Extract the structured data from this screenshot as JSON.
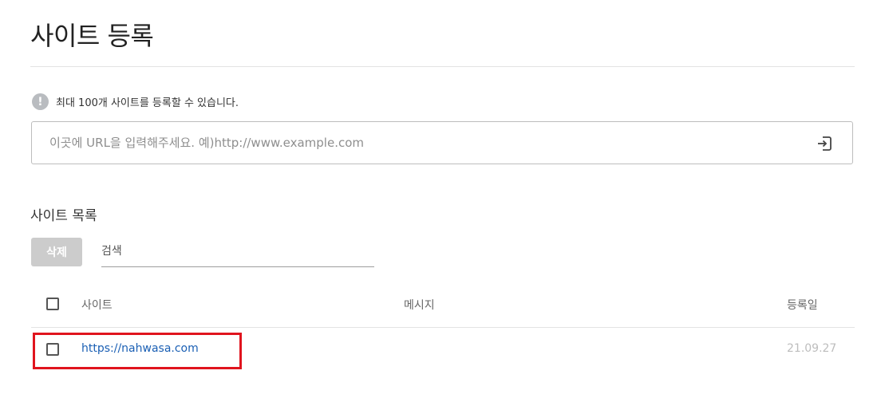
{
  "page": {
    "title": "사이트 등록"
  },
  "notice": {
    "icon": "info-icon",
    "text": "최대 100개 사이트를 등록할 수 있습니다."
  },
  "url_input": {
    "placeholder": "이곳에 URL을 입력해주세요. 예)http://www.example.com",
    "value": ""
  },
  "site_list": {
    "title": "사이트 목록",
    "delete_label": "삭제",
    "search_placeholder": "검색",
    "columns": {
      "site": "사이트",
      "message": "메시지",
      "registered": "등록일"
    },
    "rows": [
      {
        "site": "https://nahwasa.com",
        "message": "",
        "registered": "21.09.27",
        "checked": false
      }
    ]
  },
  "colors": {
    "link": "#1a5fb4",
    "highlight": "#e0141e",
    "delete_bg": "#cccccc"
  }
}
